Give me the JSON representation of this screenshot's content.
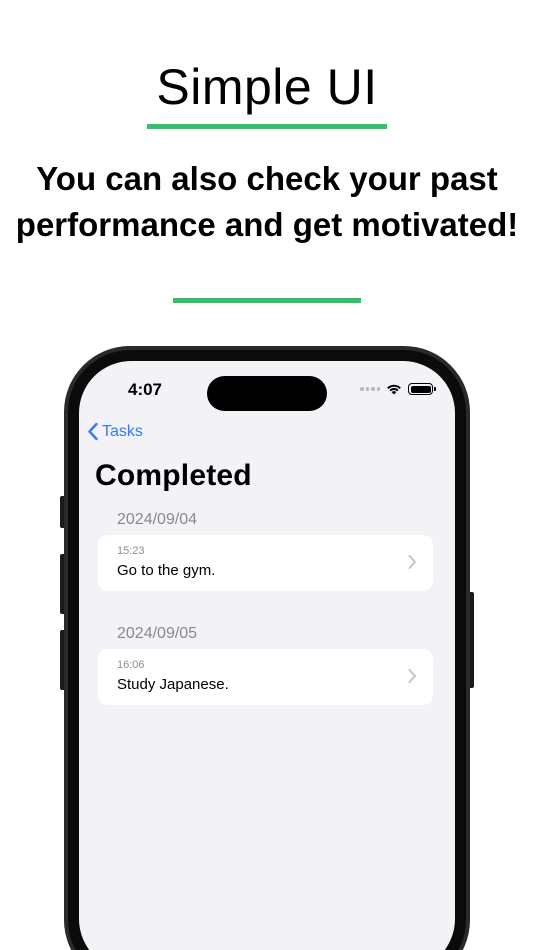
{
  "promo": {
    "headline": "Simple UI",
    "subtitle": "You can also check your past performance and get motivated!",
    "accent_color": "#2fc16c"
  },
  "status_bar": {
    "time": "4:07",
    "icons": [
      "signal-dots-icon",
      "wifi-icon",
      "battery-icon"
    ]
  },
  "nav": {
    "back_label": "Tasks",
    "back_icon": "chevron-left-icon",
    "tint_color": "#2f7cf6"
  },
  "screen": {
    "title": "Completed",
    "sections": [
      {
        "date": "2024/09/04",
        "items": [
          {
            "time": "15:23",
            "title": "Go to the gym.",
            "icon": "chevron-right-icon"
          }
        ]
      },
      {
        "date": "2024/09/05",
        "items": [
          {
            "time": "16:06",
            "title": "Study Japanese.",
            "icon": "chevron-right-icon"
          }
        ]
      }
    ]
  }
}
